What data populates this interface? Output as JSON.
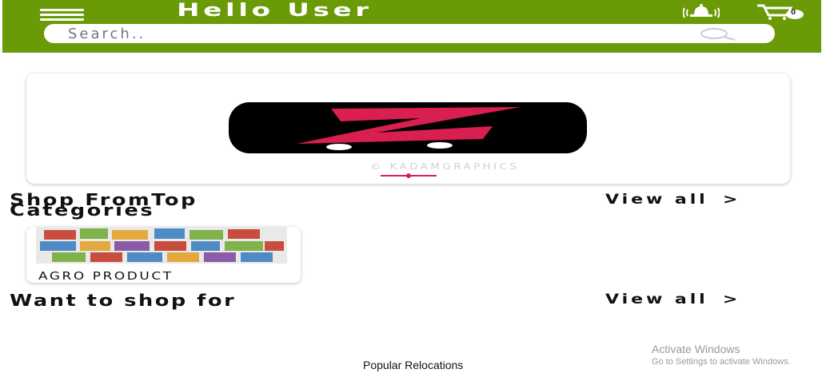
{
  "header": {
    "greeting": "Hello User",
    "menu_icon": "hamburger-menu-icon",
    "notification_icon": "bell-icon",
    "cart_icon": "cart-icon",
    "cart_count": "0",
    "bg_color": "#6a9a06"
  },
  "search": {
    "placeholder": "Search..",
    "icon": "search-icon"
  },
  "banner": {
    "watermark": "© KADAMGRAPHICS",
    "active_slide": 1
  },
  "top_categories": {
    "title_line1": "Shop FromTop",
    "title_line2": "Categories",
    "view_all": "View all",
    "chevron": ">",
    "items": [
      {
        "label": "AGRO PRODUCT"
      }
    ]
  },
  "shop_for": {
    "title": "Want to shop for",
    "view_all": "View all",
    "chevron": ">"
  },
  "footer": {
    "label": "Popular Relocations"
  },
  "system_overlay": {
    "line1": "Activate Windows",
    "line2": "Go to Settings to activate Windows."
  }
}
